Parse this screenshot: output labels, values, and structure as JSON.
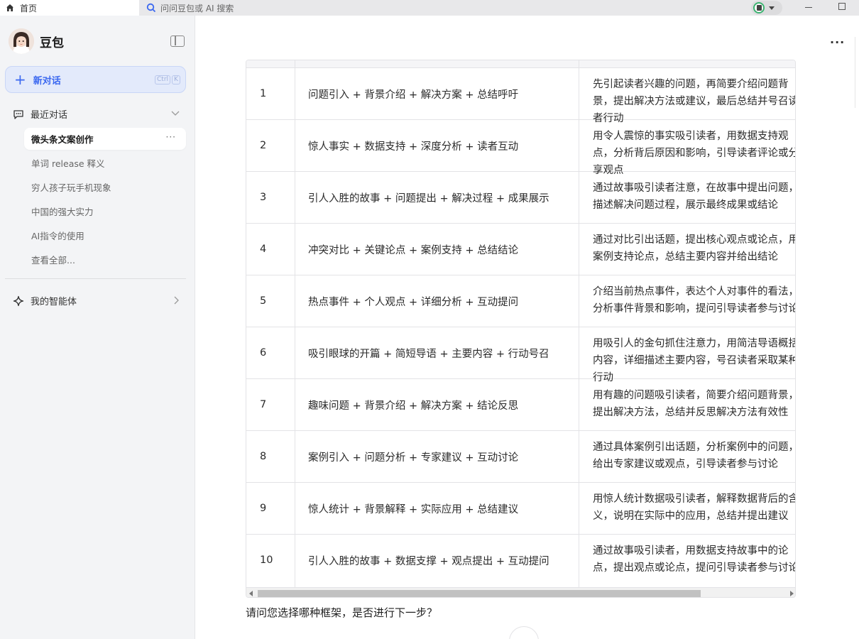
{
  "titlebar": {
    "home_tab": "首页",
    "search_placeholder": "问问豆包或 AI 搜索"
  },
  "sidebar": {
    "brand_name": "豆包",
    "new_chat_label": "新对话",
    "new_chat_shortcut": [
      "Ctrl",
      "K"
    ],
    "recent_label": "最近对话",
    "conversations": [
      {
        "label": "微头条文案创作",
        "active": true
      },
      {
        "label": "单词 release 释义",
        "active": false
      },
      {
        "label": "穷人孩子玩手机现象",
        "active": false
      },
      {
        "label": "中国的强大实力",
        "active": false
      },
      {
        "label": "AI指令的使用",
        "active": false
      },
      {
        "label": "查看全部...",
        "active": false
      }
    ],
    "agents_label": "我的智能体",
    "accent": "#3b68f0"
  },
  "table": {
    "rows": [
      {
        "num": "1",
        "frame": "问题引入 + 背景介绍 + 解决方案 + 总结呼吁",
        "desc": "先引起读者兴趣的问题，再简要介绍问题背景，提出解决方法或建议，最后总结并号召读者行动"
      },
      {
        "num": "2",
        "frame": "惊人事实 + 数据支持 + 深度分析 + 读者互动",
        "desc": "用令人震惊的事实吸引读者，用数据支持观点，分析背后原因和影响，引导读者评论或分享观点"
      },
      {
        "num": "3",
        "frame": "引人入胜的故事 + 问题提出 + 解决过程 + 成果展示",
        "desc": "通过故事吸引读者注意，在故事中提出问题，描述解决问题过程，展示最终成果或结论"
      },
      {
        "num": "4",
        "frame": "冲突对比 + 关键论点 + 案例支持 + 总结结论",
        "desc": "通过对比引出话题，提出核心观点或论点，用案例支持论点，总结主要内容并给出结论"
      },
      {
        "num": "5",
        "frame": "热点事件 + 个人观点 + 详细分析 + 互动提问",
        "desc": "介绍当前热点事件，表达个人对事件的看法，分析事件背景和影响，提问引导读者参与讨论"
      },
      {
        "num": "6",
        "frame": "吸引眼球的开篇 + 简短导语 + 主要内容 + 行动号召",
        "desc": "用吸引人的金句抓住注意力，用简洁导语概括内容，详细描述主要内容，号召读者采取某种行动"
      },
      {
        "num": "7",
        "frame": "趣味问题 + 背景介绍 + 解决方案 + 结论反思",
        "desc": "用有趣的问题吸引读者，简要介绍问题背景，提出解决方法，总结并反思解决方法有效性"
      },
      {
        "num": "8",
        "frame": "案例引入 + 问题分析 + 专家建议 + 互动讨论",
        "desc": "通过具体案例引出话题，分析案例中的问题，给出专家建议或观点，引导读者参与讨论"
      },
      {
        "num": "9",
        "frame": "惊人统计 + 背景解释 + 实际应用 + 总结建议",
        "desc": "用惊人统计数据吸引读者，解释数据背后的含义，说明在实际中的应用，总结并提出建议"
      },
      {
        "num": "10",
        "frame": "引人入胜的故事 + 数据支撑 + 观点提出 + 互动提问",
        "desc": "通过故事吸引读者，用数据支持故事中的论点，提出观点或论点，提问引导读者参与讨论"
      }
    ]
  },
  "followup_text": "请问您选择哪种框架，是否进行下一步？"
}
